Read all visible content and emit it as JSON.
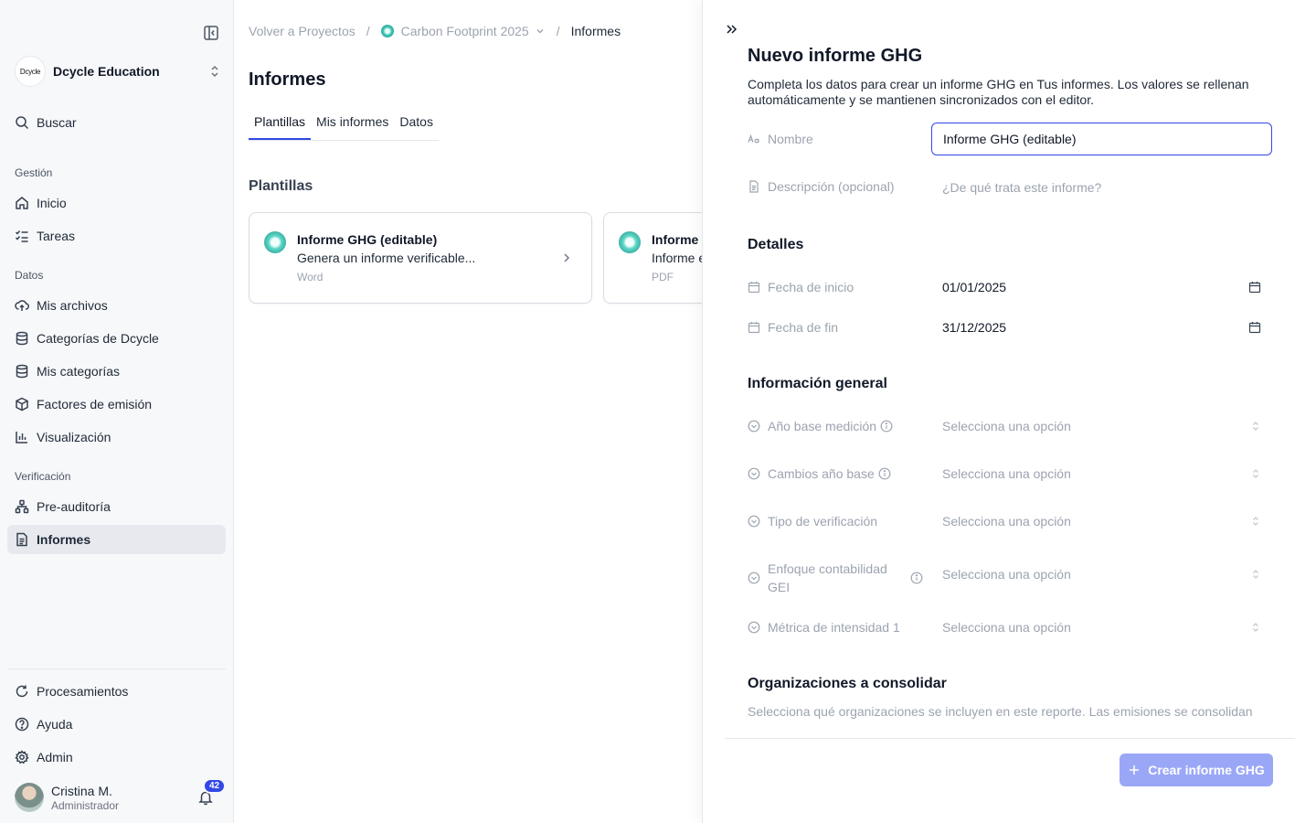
{
  "sidebar": {
    "org_logo": "Dcycle",
    "org_name": "Dcycle Education",
    "search_label": "Buscar",
    "sections": {
      "gestion": "Gestión",
      "datos": "Datos",
      "verificacion": "Verificación"
    },
    "items": {
      "inicio": "Inicio",
      "tareas": "Tareas",
      "mis_archivos": "Mis archivos",
      "categorias_dcycle": "Categorías de Dcycle",
      "mis_categorias": "Mis categorías",
      "factores": "Factores de emisión",
      "visualizacion": "Visualización",
      "pre_auditoria": "Pre-auditoría",
      "informes": "Informes"
    },
    "bottom": {
      "procesamientos": "Procesamientos",
      "ayuda": "Ayuda",
      "admin": "Admin"
    },
    "user": {
      "name": "Cristina M.",
      "role": "Administrador",
      "notifications": "42"
    }
  },
  "breadcrumb": {
    "back": "Volver a Proyectos",
    "project": "Carbon Footprint 2025",
    "current": "Informes"
  },
  "main": {
    "title": "Informes",
    "tabs": [
      "Plantillas",
      "Mis informes",
      "Datos"
    ],
    "section_title": "Plantillas",
    "cards": [
      {
        "title": "Informe GHG (editable)",
        "description": "Genera un informe verificable...",
        "type": "Word"
      },
      {
        "title": "Informe GHG",
        "description": "Informe en formato PDF...",
        "type": "PDF"
      }
    ]
  },
  "drawer": {
    "title": "Nuevo informe GHG",
    "subtitle": "Completa los datos para crear un informe GHG en Tus informes. Los valores se rellenan automáticamente y se mantienen sincronizados con el editor.",
    "name_label": "Nombre",
    "name_value": "Informe GHG (editable)",
    "description_label": "Descripción (opcional)",
    "description_placeholder": "¿De qué trata este informe?",
    "details_heading": "Detalles",
    "start_date_label": "Fecha de inicio",
    "start_date": "01/01/2025",
    "end_date_label": "Fecha de fin",
    "end_date": "31/12/2025",
    "general_heading": "Información general",
    "select_placeholder": "Selecciona una opción",
    "fields": {
      "base_year": "Año base medición",
      "base_changes": "Cambios año base",
      "verification_type": "Tipo de verificación",
      "accounting_approach": "Enfoque contabilidad GEI",
      "intensity_metric": "Métrica de intensidad 1"
    },
    "orgs_heading": "Organizaciones a consolidar",
    "orgs_description": "Selecciona qué organizaciones se incluyen en este reporte. Las emisiones se consolidan",
    "create_button": "Crear informe GHG"
  },
  "colors": {
    "accent": "#3347e6",
    "button_disabled": "#9aa7f7",
    "active_nav": "#e7e9ee",
    "project_dot": "#3dc3b4"
  }
}
